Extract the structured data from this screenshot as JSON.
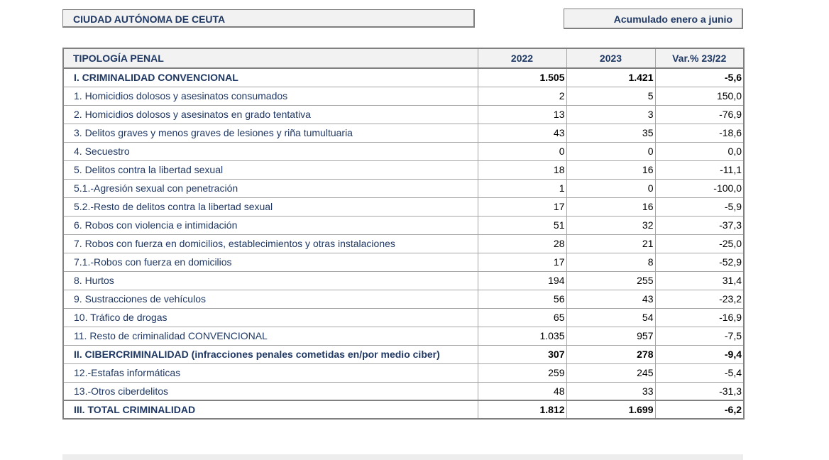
{
  "header": {
    "region": "CIUDAD AUTÓNOMA DE CEUTA",
    "period": "Acumulado enero a junio"
  },
  "table": {
    "columns": [
      "TIPOLOGÍA PENAL",
      "2022",
      "2023",
      "Var.% 23/22"
    ],
    "rows": [
      {
        "label": "I. CRIMINALIDAD CONVENCIONAL",
        "y2022": "1.505",
        "y2023": "1.421",
        "var": "-5,6",
        "bold": true
      },
      {
        "label": "1. Homicidios dolosos y asesinatos consumados",
        "y2022": "2",
        "y2023": "5",
        "var": "150,0",
        "bold": false
      },
      {
        "label": "2. Homicidios dolosos y asesinatos en grado tentativa",
        "y2022": "13",
        "y2023": "3",
        "var": "-76,9",
        "bold": false
      },
      {
        "label": "3. Delitos graves y menos graves de lesiones y riña tumultuaria",
        "y2022": "43",
        "y2023": "35",
        "var": "-18,6",
        "bold": false
      },
      {
        "label": "4. Secuestro",
        "y2022": "0",
        "y2023": "0",
        "var": "0,0",
        "bold": false
      },
      {
        "label": "5. Delitos contra la libertad sexual",
        "y2022": "18",
        "y2023": "16",
        "var": "-11,1",
        "bold": false
      },
      {
        "label": "5.1.-Agresión sexual con penetración",
        "y2022": "1",
        "y2023": "0",
        "var": "-100,0",
        "bold": false
      },
      {
        "label": "5.2.-Resto de delitos contra la libertad sexual",
        "y2022": "17",
        "y2023": "16",
        "var": "-5,9",
        "bold": false
      },
      {
        "label": "6. Robos con violencia e intimidación",
        "y2022": "51",
        "y2023": "32",
        "var": "-37,3",
        "bold": false
      },
      {
        "label": "7. Robos con fuerza en domicilios, establecimientos y otras instalaciones",
        "y2022": "28",
        "y2023": "21",
        "var": "-25,0",
        "bold": false
      },
      {
        "label": "7.1.-Robos con fuerza en domicilios",
        "y2022": "17",
        "y2023": "8",
        "var": "-52,9",
        "bold": false
      },
      {
        "label": "8. Hurtos",
        "y2022": "194",
        "y2023": "255",
        "var": "31,4",
        "bold": false
      },
      {
        "label": "9. Sustracciones de vehículos",
        "y2022": "56",
        "y2023": "43",
        "var": "-23,2",
        "bold": false
      },
      {
        "label": "10. Tráfico de drogas",
        "y2022": "65",
        "y2023": "54",
        "var": "-16,9",
        "bold": false
      },
      {
        "label": "11. Resto de criminalidad CONVENCIONAL",
        "y2022": "1.035",
        "y2023": "957",
        "var": "-7,5",
        "bold": false
      },
      {
        "label": "II. CIBERCRIMINALIDAD (infracciones penales cometidas en/por medio ciber)",
        "y2022": "307",
        "y2023": "278",
        "var": "-9,4",
        "bold": true
      },
      {
        "label": "12.-Estafas informáticas",
        "y2022": "259",
        "y2023": "245",
        "var": "-5,4",
        "bold": false
      },
      {
        "label": "13.-Otros ciberdelitos",
        "y2022": "48",
        "y2023": "33",
        "var": "-31,3",
        "bold": false
      },
      {
        "label": "III. TOTAL CRIMINALIDAD",
        "y2022": "1.812",
        "y2023": "1.699",
        "var": "-6,2",
        "bold": true
      }
    ]
  }
}
